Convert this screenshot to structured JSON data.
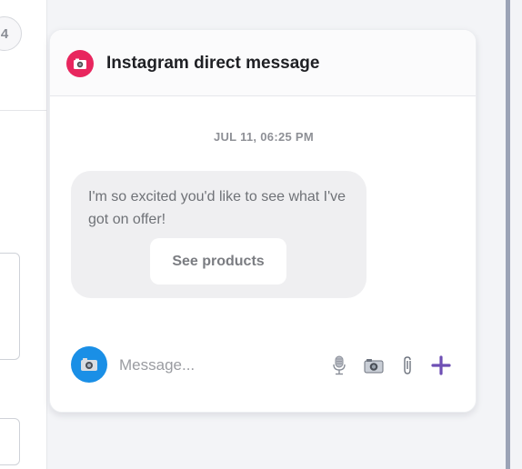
{
  "left_panel": {
    "step_number": "4"
  },
  "card": {
    "title": "Instagram direct message",
    "timestamp": "JUL 11, 06:25 PM",
    "message": {
      "text": "I'm so excited you'd like to see what I've got on offer!",
      "button_label": "See products"
    },
    "composer": {
      "placeholder": "Message...",
      "tools": [
        "microphone-icon",
        "camera-icon",
        "paperclip-icon",
        "plus-icon"
      ]
    }
  },
  "colors": {
    "instagram_avatar": "#e8265e",
    "user_avatar": "#1a8fe6",
    "plus_accent": "#6e4fb4",
    "bubble_bg": "#efeff1"
  }
}
